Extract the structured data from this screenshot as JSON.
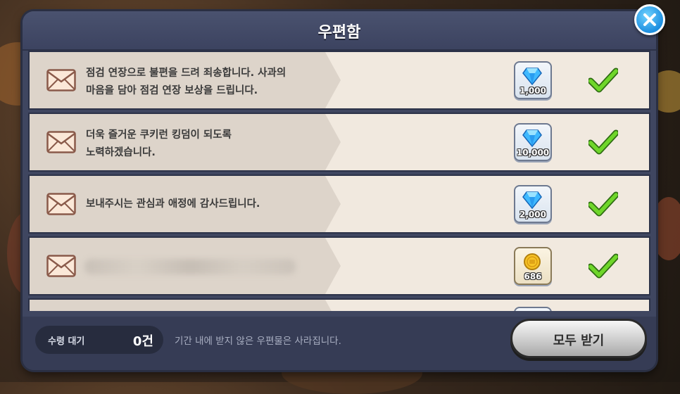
{
  "title": "우편함",
  "mails": [
    {
      "message": "점검 연장으로 불편을 드려 죄송합니다. 사과의\n마음을 담아 점검 연장 보상을 드립니다.",
      "reward_icon": "crystal-icon",
      "reward_amount": "1,000"
    },
    {
      "message": "더욱 즐거운 쿠키런 킹덤이 되도록\n노력하겠습니다.",
      "reward_icon": "crystal-icon",
      "reward_amount": "10,000"
    },
    {
      "message": "보내주시는 관심과 애정에 감사드립니다.",
      "reward_icon": "crystal-icon",
      "reward_amount": "2,000"
    },
    {
      "message": "",
      "reward_icon": "coin-icon",
      "reward_amount": "686"
    }
  ],
  "footer": {
    "pending_label": "수령 대기",
    "pending_count": "0건",
    "notice": "기간 내에 받지 않은 우편물은 사라집니다.",
    "claim_all": "모두 받기"
  },
  "colors": {
    "panel": "#3f4660",
    "row": "#f1e9df",
    "check": "#5cc21c",
    "close": "#1e8fe0"
  }
}
